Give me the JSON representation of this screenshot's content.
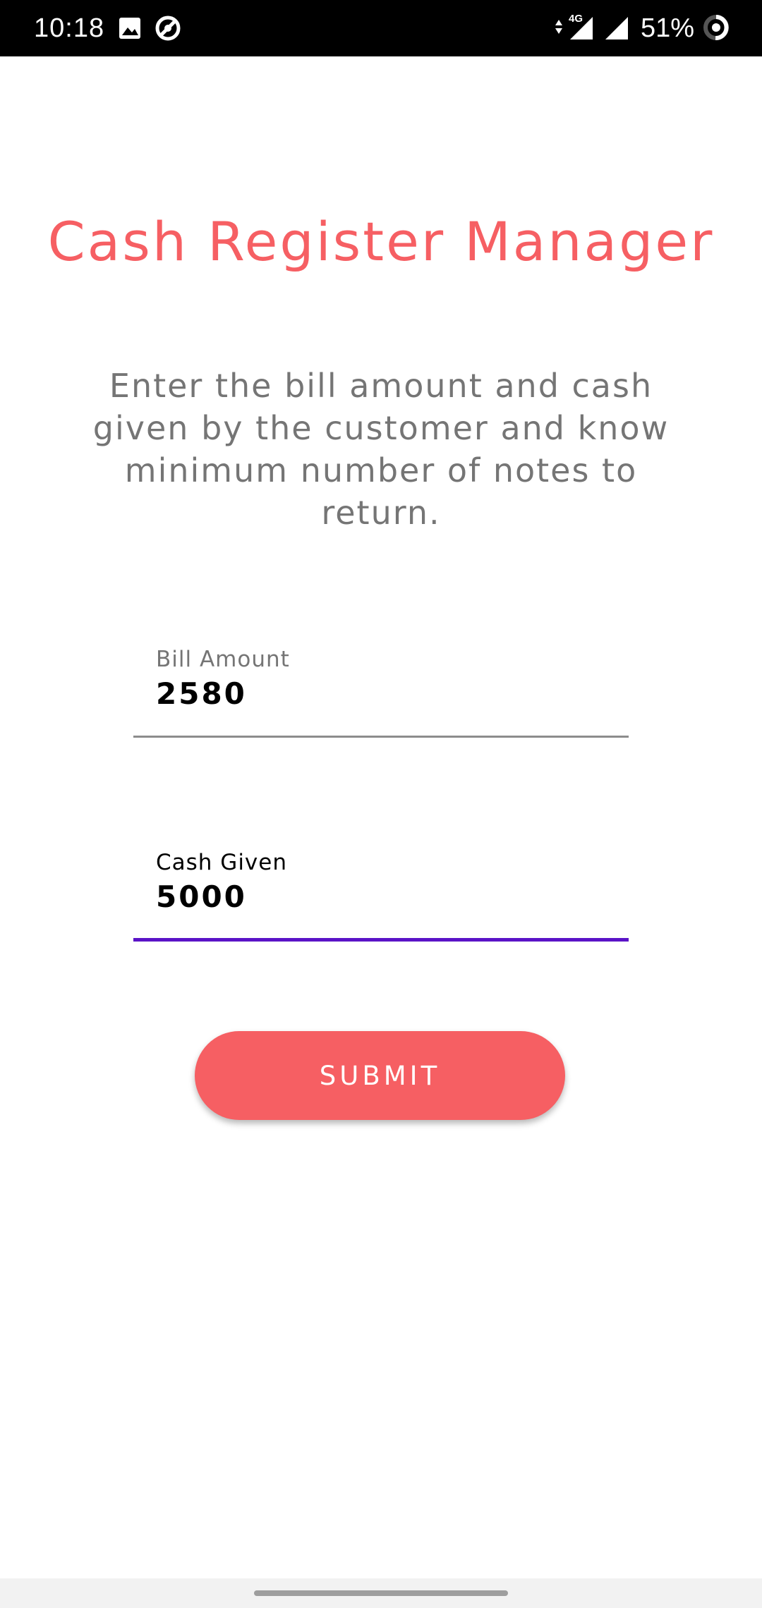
{
  "status_bar": {
    "time": "10:18",
    "network": "4G",
    "battery": "51%",
    "icons": [
      "image-icon",
      "sync-icon",
      "data-arrows-icon",
      "signal-icon",
      "signal-icon",
      "battery-ring-icon"
    ]
  },
  "app": {
    "title": "Cash Register Manager",
    "description": "Enter the bill amount and cash given by the customer and know minimum number of notes to return."
  },
  "form": {
    "bill_amount": {
      "label": "Bill Amount",
      "value": "2580"
    },
    "cash_given": {
      "label": "Cash Given",
      "value": "5000"
    },
    "submit_label": "SUBMIT"
  },
  "colors": {
    "accent": "#f65f63",
    "focus_underline": "#5a13c7",
    "idle_underline": "#8c8c8c",
    "status_bar": "#000000",
    "muted_text": "#757575"
  }
}
